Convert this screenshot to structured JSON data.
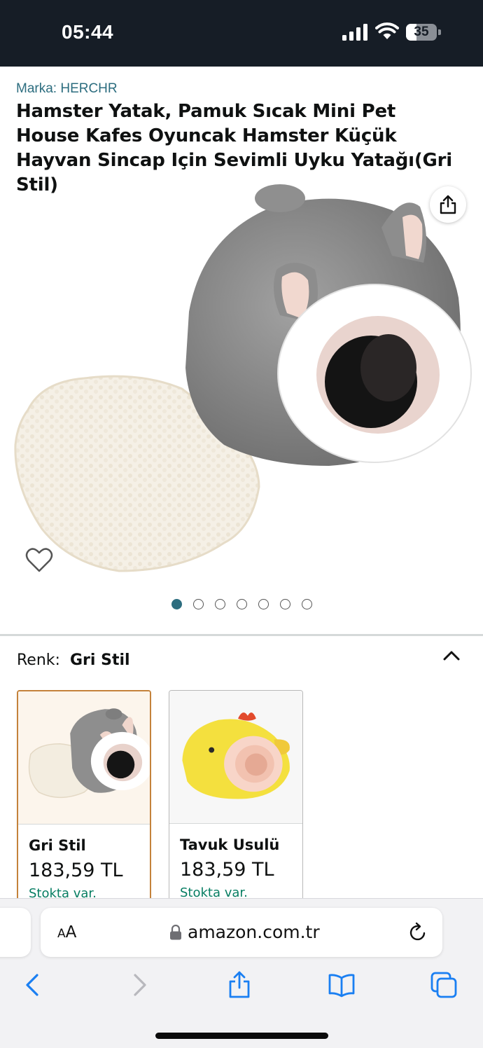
{
  "status_bar": {
    "time": "05:44",
    "battery_level": "35",
    "battery_fraction": 0.35,
    "icons": [
      "cellular-signal-icon",
      "wifi-icon",
      "battery-icon"
    ]
  },
  "product": {
    "brand": "Marka: HERCHR",
    "title": "Hamster Yatak, Pamuk Sıcak Mini Pet House Kafes Oyuncak Hamster Küçük Hayvan Sincap Için Sevimli Uyku Yatağı(Gri Stil)"
  },
  "gallery": {
    "image_count": 7,
    "active_index": 0,
    "icons": [
      "share-icon",
      "heart-icon"
    ]
  },
  "variant": {
    "label": "Renk:",
    "selected_value": "Gri Stil",
    "options": [
      {
        "name": "Gri Stil",
        "price": "183,59 TL",
        "stock": "Stokta var.",
        "selected": true
      },
      {
        "name": "Tavuk Usulü",
        "price": "183,59 TL",
        "stock": "Stokta var.",
        "selected": false
      }
    ]
  },
  "browser": {
    "text_size_label_small": "A",
    "text_size_label_large": "A",
    "url": "amazon.com.tr",
    "toolbar_icons": [
      "back-icon",
      "forward-icon",
      "share-icon",
      "bookmarks-icon",
      "tabs-icon"
    ]
  },
  "colors": {
    "status_bar_bg": "#161d26",
    "brand_link": "#2c6d7f",
    "active_dot": "#2c6d7f",
    "stock_green": "#067d62",
    "selected_border": "#c4823b",
    "browser_blue": "#1a7ff2"
  }
}
